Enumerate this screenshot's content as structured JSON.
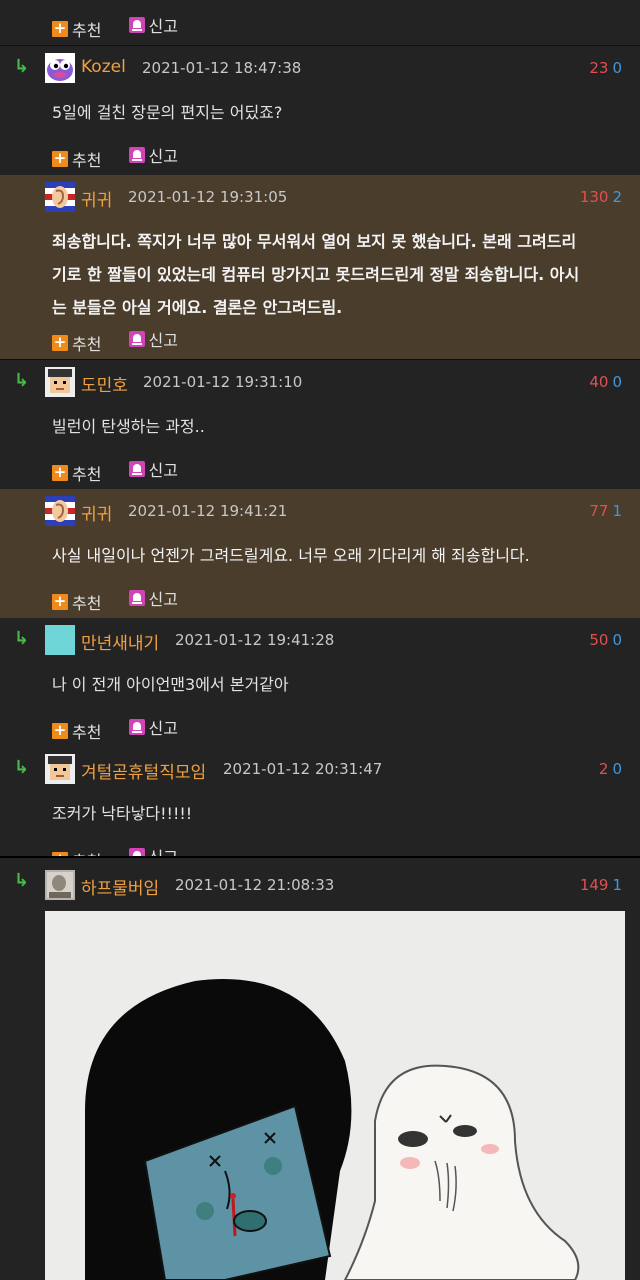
{
  "labels": {
    "recommend": "추천",
    "report": "신고"
  },
  "colors": {
    "nick": "#f0a040",
    "upvote": "#e05050",
    "downvote": "#3d98e0",
    "op_bg": "#4a3d2c",
    "reply_arrow": "#48b848"
  },
  "comments": [
    {
      "nick": "Kozel",
      "time": "2021-01-12 18:47:38",
      "up": "23",
      "down": "0",
      "text": "5일에 걸친 장문의 편지는 어딨죠?",
      "avatar": "purple-creature-avatar"
    },
    {
      "nick": "귀귀",
      "time": "2021-01-12 19:31:05",
      "up": "130",
      "down": "2",
      "text_lines": [
        "죄송합니다. 쪽지가 너무 많아 무서워서 열어 보지 못 했습니다. 본래 그려드리",
        "기로 한 짤들이 있었는데 컴퓨터 망가지고 못드려드린게 정말 죄송합니다. 아시",
        "는 분들은 아실 거에요. 결론은 안그려드림."
      ],
      "avatar": "ear-flag-avatar"
    },
    {
      "nick": "도민호",
      "time": "2021-01-12 19:31:10",
      "up": "40",
      "down": "0",
      "text": "빌런이 탄생하는 과정..",
      "avatar": "pixel-face-avatar"
    },
    {
      "nick": "귀귀",
      "time": "2021-01-12 19:41:21",
      "up": "77",
      "down": "1",
      "text": "사실 내일이나 언젠가 그려드릴게요. 너무 오래 기다리게 해 죄송합니다.",
      "avatar": "ear-flag-avatar"
    },
    {
      "nick": "만년새내기",
      "time": "2021-01-12 19:41:28",
      "up": "50",
      "down": "0",
      "text": "나 이 전개 아이언맨3에서 본거같아",
      "avatar": "cyan-square-avatar"
    },
    {
      "nick": "겨털곧휴털직모임",
      "time": "2021-01-12 20:31:47",
      "up": "2",
      "down": "0",
      "text": "조커가 낙타낳다!!!!!",
      "avatar": "pixel-face-avatar"
    },
    {
      "nick": "하프물버임",
      "time": "2021-01-12 21:08:33",
      "up": "149",
      "down": "1",
      "avatar": "photo-avatar"
    }
  ]
}
